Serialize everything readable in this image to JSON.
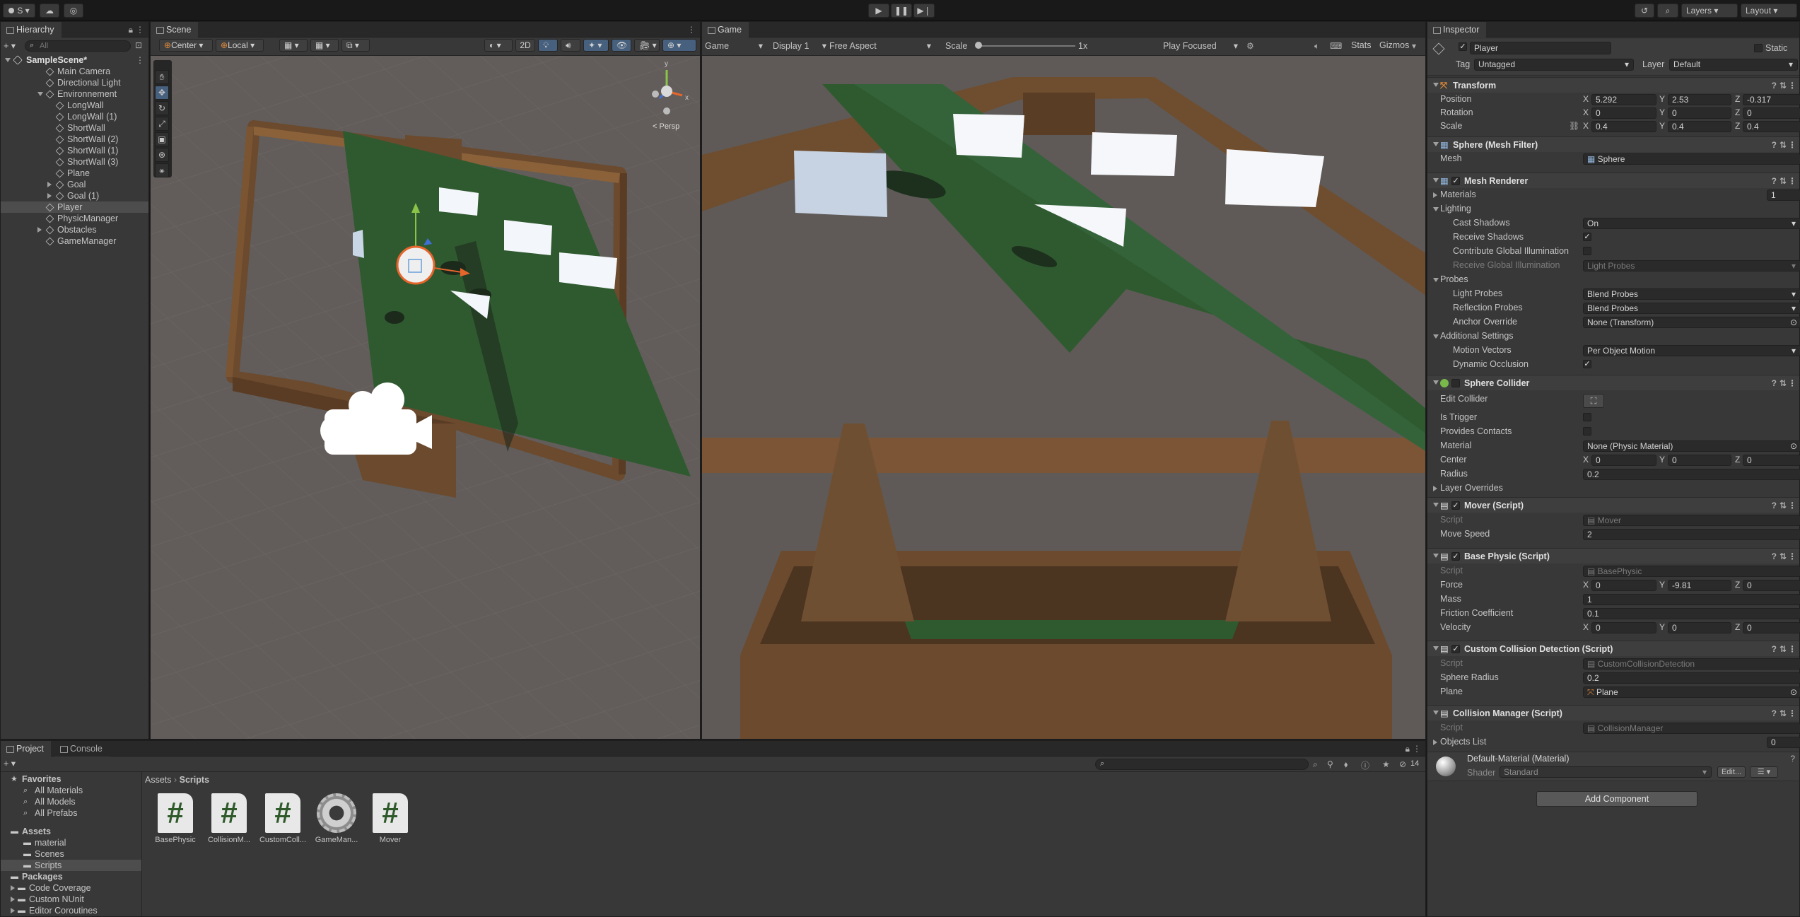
{
  "toolbar": {
    "account_label": "S",
    "play_icon": "play-icon",
    "pause_icon": "pause-icon",
    "step_icon": "step-icon",
    "layers_label": "Layers",
    "layout_label": "Layout"
  },
  "hierarchy": {
    "tab_label": "Hierarchy",
    "search_placeholder": "All",
    "scene_name": "SampleScene*",
    "items": [
      {
        "label": "Main Camera",
        "depth": 1
      },
      {
        "label": "Directional Light",
        "depth": 1
      },
      {
        "label": "Environnement",
        "depth": 1,
        "expanded": true
      },
      {
        "label": "LongWall",
        "depth": 2
      },
      {
        "label": "LongWall (1)",
        "depth": 2
      },
      {
        "label": "ShortWall",
        "depth": 2
      },
      {
        "label": "ShortWall (2)",
        "depth": 2
      },
      {
        "label": "ShortWall (1)",
        "depth": 2
      },
      {
        "label": "ShortWall (3)",
        "depth": 2
      },
      {
        "label": "Plane",
        "depth": 2
      },
      {
        "label": "Goal",
        "depth": 2,
        "collapsed": true
      },
      {
        "label": "Goal (1)",
        "depth": 2,
        "collapsed": true
      },
      {
        "label": "Player",
        "depth": 1,
        "selected": true
      },
      {
        "label": "PhysicManager",
        "depth": 1
      },
      {
        "label": "Obstacles",
        "depth": 1,
        "collapsed": true
      },
      {
        "label": "GameManager",
        "depth": 1
      }
    ]
  },
  "scene": {
    "tab_label": "Scene",
    "pivot_label": "Center",
    "space_label": "Local",
    "mode_2d": "2D",
    "persp_label": "< Persp",
    "gizmo_x": "x",
    "gizmo_y": "y"
  },
  "game": {
    "tab_label": "Game",
    "view_label": "Game",
    "display_label": "Display 1",
    "aspect_label": "Free Aspect",
    "scale_label": "Scale",
    "scale_value": "1x",
    "play_mode_label": "Play Focused",
    "stats_label": "Stats",
    "gizmos_label": "Gizmos"
  },
  "inspector": {
    "tab_label": "Inspector",
    "object_name": "Player",
    "static_label": "Static",
    "tag_label": "Tag",
    "tag_value": "Untagged",
    "layer_label": "Layer",
    "layer_value": "Default",
    "transform": {
      "title": "Transform",
      "position_label": "Position",
      "position": {
        "x": "5.292",
        "y": "2.53",
        "z": "-0.317"
      },
      "rotation_label": "Rotation",
      "rotation": {
        "x": "0",
        "y": "0",
        "z": "0"
      },
      "scale_label": "Scale",
      "scale": {
        "x": "0.4",
        "y": "0.4",
        "z": "0.4"
      }
    },
    "mesh_filter": {
      "title": "Sphere (Mesh Filter)",
      "mesh_label": "Mesh",
      "mesh_value": "Sphere"
    },
    "mesh_renderer": {
      "title": "Mesh Renderer",
      "materials_label": "Materials",
      "materials_count": "1",
      "lighting_label": "Lighting",
      "cast_shadows_label": "Cast Shadows",
      "cast_shadows_value": "On",
      "receive_shadows_label": "Receive Shadows",
      "contribute_gi_label": "Contribute Global Illumination",
      "receive_gi_label": "Receive Global Illumination",
      "receive_gi_value": "Light Probes",
      "probes_label": "Probes",
      "light_probes_label": "Light Probes",
      "light_probes_value": "Blend Probes",
      "reflection_probes_label": "Reflection Probes",
      "reflection_probes_value": "Blend Probes",
      "anchor_override_label": "Anchor Override",
      "anchor_override_value": "None (Transform)",
      "additional_label": "Additional Settings",
      "motion_vectors_label": "Motion Vectors",
      "motion_vectors_value": "Per Object Motion",
      "dynamic_occlusion_label": "Dynamic Occlusion"
    },
    "sphere_collider": {
      "title": "Sphere Collider",
      "edit_collider_label": "Edit Collider",
      "is_trigger_label": "Is Trigger",
      "provides_contacts_label": "Provides Contacts",
      "material_label": "Material",
      "material_value": "None (Physic Material)",
      "center_label": "Center",
      "center": {
        "x": "0",
        "y": "0",
        "z": "0"
      },
      "radius_label": "Radius",
      "radius_value": "0.2",
      "layer_overrides_label": "Layer Overrides"
    },
    "mover": {
      "title": "Mover (Script)",
      "script_label": "Script",
      "script_value": "Mover",
      "move_speed_label": "Move Speed",
      "move_speed_value": "2"
    },
    "base_physic": {
      "title": "Base Physic (Script)",
      "script_label": "Script",
      "script_value": "BasePhysic",
      "force_label": "Force",
      "force": {
        "x": "0",
        "y": "-9.81",
        "z": "0"
      },
      "mass_label": "Mass",
      "mass_value": "1",
      "friction_label": "Friction Coefficient",
      "friction_value": "0.1",
      "velocity_label": "Velocity",
      "velocity": {
        "x": "0",
        "y": "0",
        "z": "0"
      }
    },
    "custom_collision": {
      "title": "Custom Collision Detection (Script)",
      "script_label": "Script",
      "script_value": "CustomCollisionDetection",
      "sphere_radius_label": "Sphere Radius",
      "sphere_radius_value": "0.2",
      "plane_label": "Plane",
      "plane_value": "Plane"
    },
    "collision_manager": {
      "title": "Collision Manager (Script)",
      "script_label": "Script",
      "script_value": "CollisionManager",
      "objects_list_label": "Objects List",
      "objects_list_count": "0"
    },
    "material": {
      "title": "Default-Material (Material)",
      "shader_label": "Shader",
      "shader_value": "Standard",
      "edit_label": "Edit..."
    },
    "add_component_label": "Add Component"
  },
  "project": {
    "tab_label": "Project",
    "console_tab_label": "Console",
    "badge_count": "14",
    "breadcrumb": [
      "Assets",
      "Scripts"
    ],
    "favorites_label": "Favorites",
    "favorites": [
      "All Materials",
      "All Models",
      "All Prefabs"
    ],
    "assets_label": "Assets",
    "asset_folders": [
      "material",
      "Scenes",
      "Scripts"
    ],
    "packages_label": "Packages",
    "package_folders": [
      "Code Coverage",
      "Custom NUnit",
      "Editor Coroutines"
    ],
    "files": [
      {
        "label": "BasePhysic",
        "icon": "csharp-script-icon"
      },
      {
        "label": "CollisionM...",
        "icon": "csharp-script-icon"
      },
      {
        "label": "CustomColl...",
        "icon": "csharp-script-icon"
      },
      {
        "label": "GameMan...",
        "icon": "gear-icon"
      },
      {
        "label": "Mover",
        "icon": "csharp-script-icon"
      }
    ]
  },
  "colors": {
    "panel_bg": "#383838",
    "toolbar_bg": "#191919",
    "selection": "#4d4d4d",
    "plane_green": "#2f5a2f",
    "wall_brown": "#6b4a2e",
    "ground": "#5e5a57",
    "sky_scene": "#6a6866"
  }
}
